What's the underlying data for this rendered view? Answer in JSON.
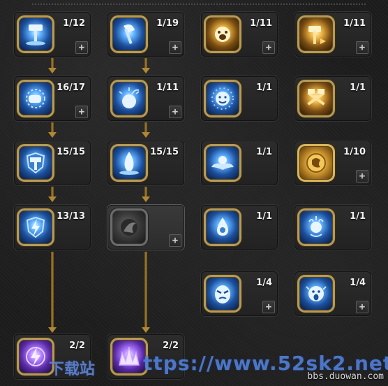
{
  "skills": [
    {
      "count": "1/12",
      "color": "blue",
      "icon": "hammer-slam-icon",
      "plus": "+"
    },
    {
      "count": "1/19",
      "color": "blue",
      "icon": "axe-icon",
      "plus": "+"
    },
    {
      "count": "1/11",
      "color": "gold",
      "icon": "roaring-face-icon",
      "plus": "+"
    },
    {
      "count": "1/11",
      "color": "gold",
      "icon": "hammer-strike-icon",
      "plus": "+"
    },
    {
      "count": "16/17",
      "color": "blue",
      "icon": "fist-burst-icon",
      "plus": "+"
    },
    {
      "count": "1/11",
      "color": "blue",
      "icon": "bomb-icon",
      "plus": "+"
    },
    {
      "count": "1/1",
      "color": "blue",
      "icon": "sun-face-icon",
      "plus": ""
    },
    {
      "count": "1/1",
      "color": "gold",
      "icon": "crossed-hammers-icon",
      "plus": ""
    },
    {
      "count": "15/15",
      "color": "blue",
      "icon": "shield-hammer-icon",
      "plus": ""
    },
    {
      "count": "15/15",
      "color": "blue",
      "icon": "blue-flame-icon",
      "plus": ""
    },
    {
      "count": "1/1",
      "color": "blue",
      "icon": "winged-spirit-icon",
      "plus": ""
    },
    {
      "count": "1/10",
      "color": "goldplate",
      "icon": "gold-medallion-icon",
      "plus": "+"
    },
    {
      "count": "13/13",
      "color": "blue",
      "icon": "lightning-shield-icon",
      "plus": ""
    },
    {
      "count": "",
      "color": "grey",
      "icon": "locked-skill-icon",
      "plus": "+"
    },
    {
      "count": "1/1",
      "color": "blue",
      "icon": "water-drop-icon",
      "plus": ""
    },
    {
      "count": "1/1",
      "color": "blue",
      "icon": "flame-spirit-icon",
      "plus": ""
    },
    {
      "count": "1/4",
      "color": "blue",
      "icon": "angry-mask-icon",
      "plus": "+"
    },
    {
      "count": "1/4",
      "color": "blue",
      "icon": "screaming-face-icon",
      "plus": "+"
    },
    {
      "count": "2/2",
      "color": "purple",
      "icon": "purple-lightning-icon",
      "plus": ""
    },
    {
      "count": "2/2",
      "color": "purple",
      "icon": "crystal-crown-icon",
      "plus": ""
    }
  ],
  "watermark": {
    "left": "下载站",
    "main": "ttps://www.52sk2.net",
    "site": "bbs.duowan.com"
  },
  "colors": {
    "gold_frame": "#b69a56",
    "link": "#a8812f",
    "blue_watermark": "#5a8ce6"
  }
}
